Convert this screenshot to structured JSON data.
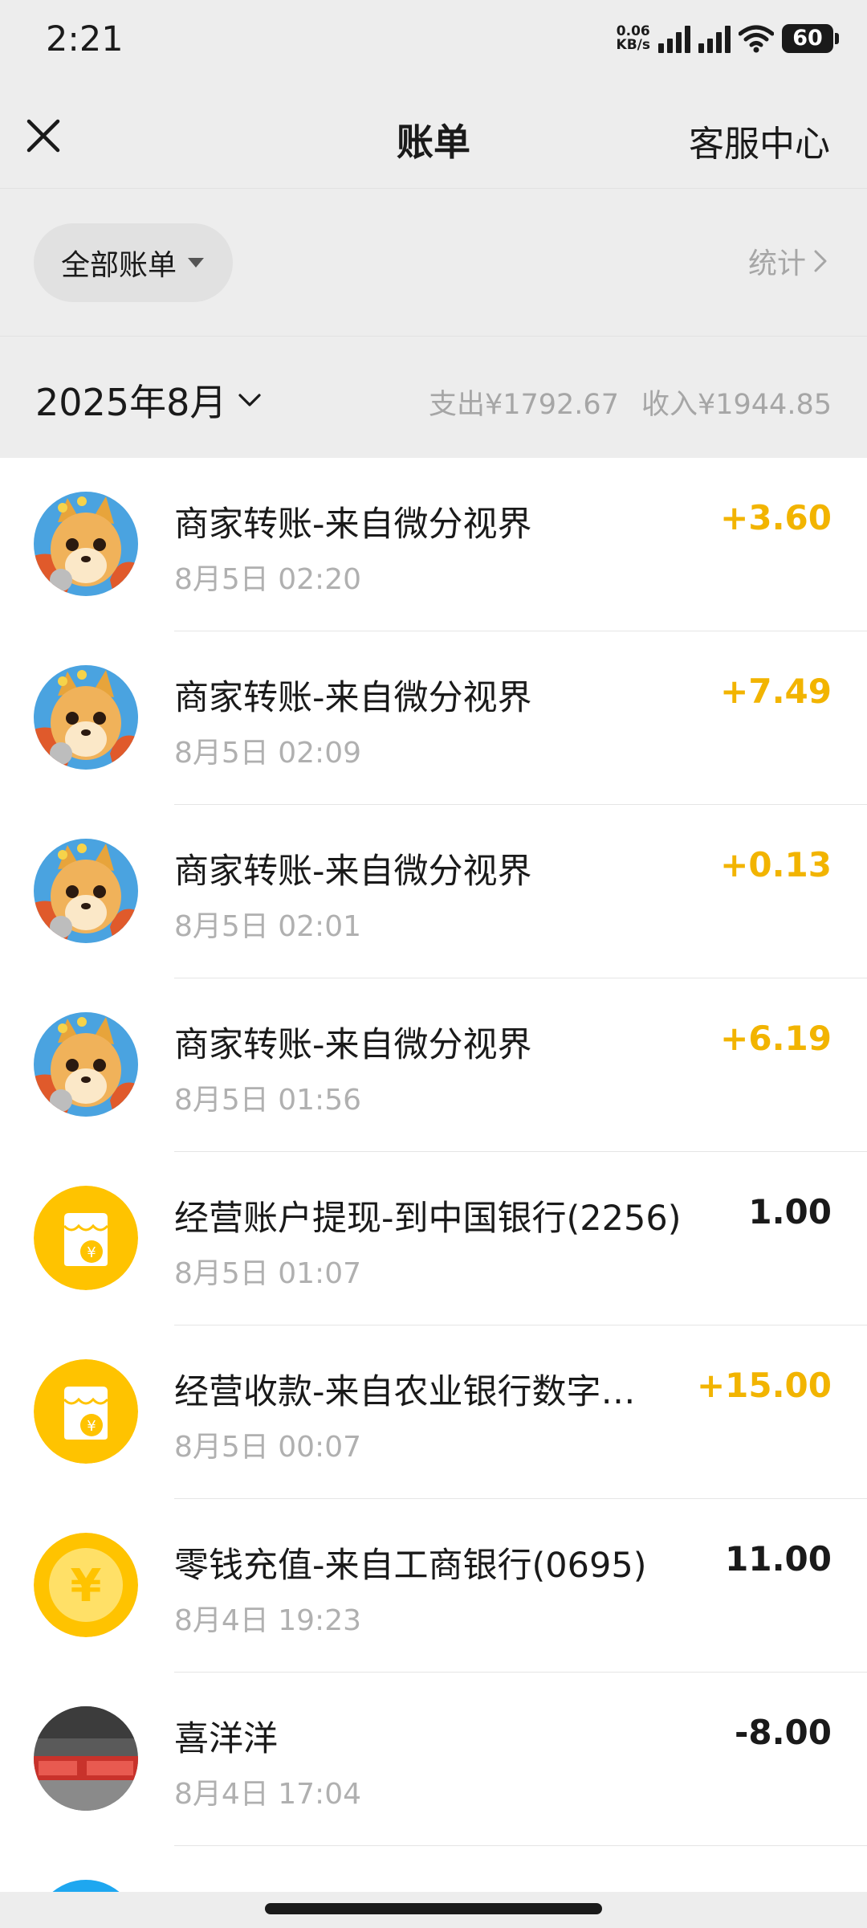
{
  "status_bar": {
    "time": "2:21",
    "net_speed_value": "0.06",
    "net_speed_unit": "KB/s",
    "battery": "60"
  },
  "navbar": {
    "title": "账单",
    "right_link": "客服中心"
  },
  "filter": {
    "label": "全部账单",
    "stats_link": "统计"
  },
  "month": {
    "label": "2025年8月",
    "expense": "支出¥1792.67",
    "income": "收入¥1944.85"
  },
  "transactions": [
    {
      "title": "商家转账-来自微分视界",
      "time": "8月5日 02:20",
      "amount": "+3.60",
      "kind": "income",
      "avatar": "dog-avatar"
    },
    {
      "title": "商家转账-来自微分视界",
      "time": "8月5日 02:09",
      "amount": "+7.49",
      "kind": "income",
      "avatar": "dog-avatar"
    },
    {
      "title": "商家转账-来自微分视界",
      "time": "8月5日 02:01",
      "amount": "+0.13",
      "kind": "income",
      "avatar": "dog-avatar"
    },
    {
      "title": "商家转账-来自微分视界",
      "time": "8月5日 01:56",
      "amount": "+6.19",
      "kind": "income",
      "avatar": "dog-avatar"
    },
    {
      "title": "经营账户提现-到中国银行(2256)",
      "time": "8月5日 01:07",
      "amount": "1.00",
      "kind": "neutral",
      "avatar": "shop-icon"
    },
    {
      "title": "经营收款-来自农业银行数字…",
      "time": "8月5日 00:07",
      "amount": "+15.00",
      "kind": "income",
      "avatar": "shop-icon"
    },
    {
      "title": "零钱充值-来自工商银行(0695)",
      "time": "8月4日 19:23",
      "amount": "11.00",
      "kind": "neutral",
      "avatar": "yuan-coin-icon"
    },
    {
      "title": "喜洋洋",
      "time": "8月4日 17:04",
      "amount": "-8.00",
      "kind": "neutral",
      "avatar": "photo-avatar"
    }
  ],
  "colors": {
    "income": "#f2b400",
    "background_gray": "#ededed",
    "brand_yellow": "#ffc300"
  }
}
